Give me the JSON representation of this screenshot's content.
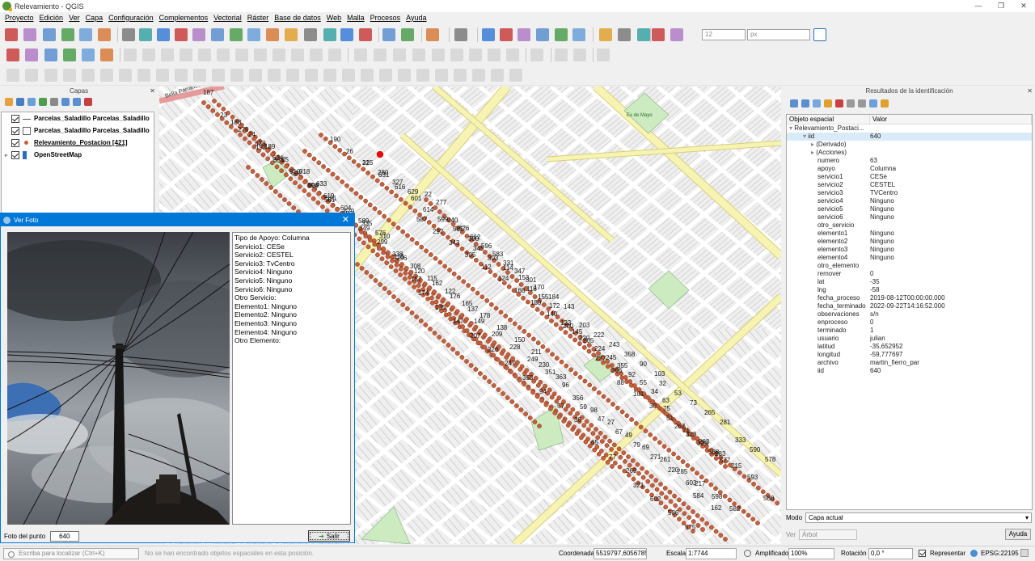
{
  "window": {
    "title": "Relevamiento - QGIS",
    "minimize": "—",
    "maximize": "❐",
    "close": "✕"
  },
  "menu": [
    "Proyecto",
    "Edición",
    "Ver",
    "Capa",
    "Configuración",
    "Complementos",
    "Vectorial",
    "Ráster",
    "Base de datos",
    "Web",
    "Malla",
    "Procesos",
    "Ayuda"
  ],
  "toolbar": {
    "scale_combo": "12",
    "unit_combo": "px"
  },
  "layers_panel": {
    "title": "Capas",
    "close": "✕",
    "layers": [
      {
        "name": "Parcelas_Saladillo Parcelas_Saladillo",
        "symbol": "line"
      },
      {
        "name": "Parcelas_Saladillo Parcelas_Saladillo",
        "symbol": "polygon"
      },
      {
        "name": "Relevamiento_Postacion [421]",
        "symbol": "point"
      },
      {
        "name": "OpenStreetMap",
        "symbol": "raster"
      }
    ]
  },
  "dialog": {
    "title": "Ver Foto",
    "close": "✕",
    "info": [
      "Tipo de Apoyo: Columna",
      "Servicio1: CESe",
      "Servicio2: CESTEL",
      "Servicio3: TvCentro",
      "Servicio4: Ninguno",
      "Servicio5: Ninguno",
      "Servicio6: Ninguno",
      "Otro Servicio:",
      "Elemento1: Ninguno",
      "Elemento2: Ninguno",
      "Elemento3: Ninguno",
      "Elemento4: Ninguno",
      "Otro Elemento:"
    ],
    "photo_label": "Foto del punto",
    "photo_value": "640",
    "exit_label": "Salir"
  },
  "map": {
    "street_label": "Bella Parranosa",
    "plaza_label": "Ex de Mayo",
    "point_labels": [
      {
        "t": "187"
      },
      {
        "t": "188"
      },
      {
        "t": "189"
      },
      {
        "t": "190"
      },
      {
        "t": "21"
      },
      {
        "t": "22"
      },
      {
        "t": "23"
      },
      {
        "t": "24"
      },
      {
        "t": "25"
      },
      {
        "t": "26"
      },
      {
        "t": "280"
      },
      {
        "t": "277"
      },
      {
        "t": "276"
      },
      {
        "t": "193"
      },
      {
        "t": "318"
      },
      {
        "t": "325"
      },
      {
        "t": "327"
      },
      {
        "t": "240"
      },
      {
        "t": "638"
      },
      {
        "t": "635"
      },
      {
        "t": "633"
      },
      {
        "t": "631"
      },
      {
        "t": "629"
      },
      {
        "t": "626"
      },
      {
        "t": "624"
      },
      {
        "t": "622"
      },
      {
        "t": "619"
      },
      {
        "t": "616"
      },
      {
        "t": "614"
      },
      {
        "t": "612"
      },
      {
        "t": "610"
      },
      {
        "t": "608"
      },
      {
        "t": "604"
      },
      {
        "t": "601"
      },
      {
        "t": "599"
      },
      {
        "t": "596"
      },
      {
        "t": "594"
      },
      {
        "t": "591"
      },
      {
        "t": "589"
      },
      {
        "t": "587"
      },
      {
        "t": "585"
      },
      {
        "t": "583"
      },
      {
        "t": "581"
      },
      {
        "t": "579"
      },
      {
        "t": "576"
      },
      {
        "t": "292"
      },
      {
        "t": "330"
      },
      {
        "t": "331"
      },
      {
        "t": "332"
      },
      {
        "t": "335"
      },
      {
        "t": "338"
      },
      {
        "t": "343"
      },
      {
        "t": "345"
      },
      {
        "t": "347"
      },
      {
        "t": "349"
      },
      {
        "t": "310"
      },
      {
        "t": "308"
      },
      {
        "t": "305"
      },
      {
        "t": "303"
      },
      {
        "t": "301"
      },
      {
        "t": "299"
      },
      {
        "t": "296"
      },
      {
        "t": "115"
      },
      {
        "t": "112"
      },
      {
        "t": "114"
      },
      {
        "t": "116"
      },
      {
        "t": "118"
      },
      {
        "t": "120"
      },
      {
        "t": "122"
      },
      {
        "t": "124"
      },
      {
        "t": "153"
      },
      {
        "t": "155"
      },
      {
        "t": "157"
      },
      {
        "t": "162"
      },
      {
        "t": "165"
      },
      {
        "t": "168"
      },
      {
        "t": "170"
      },
      {
        "t": "172"
      },
      {
        "t": "174"
      },
      {
        "t": "176"
      },
      {
        "t": "178"
      },
      {
        "t": "180"
      },
      {
        "t": "184"
      },
      {
        "t": "133"
      },
      {
        "t": "135"
      },
      {
        "t": "137"
      },
      {
        "t": "138"
      },
      {
        "t": "140"
      },
      {
        "t": "143"
      },
      {
        "t": "145"
      },
      {
        "t": "147"
      },
      {
        "t": "149"
      },
      {
        "t": "150"
      },
      {
        "t": "200"
      },
      {
        "t": "203"
      },
      {
        "t": "205"
      },
      {
        "t": "207"
      },
      {
        "t": "209"
      },
      {
        "t": "211"
      },
      {
        "t": "220"
      },
      {
        "t": "222"
      },
      {
        "t": "224"
      },
      {
        "t": "226"
      },
      {
        "t": "228"
      },
      {
        "t": "230"
      },
      {
        "t": "237"
      },
      {
        "t": "243"
      },
      {
        "t": "245"
      },
      {
        "t": "247"
      },
      {
        "t": "249"
      },
      {
        "t": "363"
      },
      {
        "t": "366"
      },
      {
        "t": "358"
      },
      {
        "t": "355"
      },
      {
        "t": "353"
      },
      {
        "t": "351"
      },
      {
        "t": "356"
      },
      {
        "t": "88"
      },
      {
        "t": "90"
      },
      {
        "t": "92"
      },
      {
        "t": "94"
      },
      {
        "t": "96"
      },
      {
        "t": "98"
      },
      {
        "t": "101"
      },
      {
        "t": "103"
      },
      {
        "t": "55"
      },
      {
        "t": "57"
      },
      {
        "t": "59"
      },
      {
        "t": "27"
      },
      {
        "t": "30"
      },
      {
        "t": "32"
      },
      {
        "t": "34"
      },
      {
        "t": "36"
      },
      {
        "t": "47"
      },
      {
        "t": "49"
      },
      {
        "t": "51"
      },
      {
        "t": "53"
      },
      {
        "t": "63"
      },
      {
        "t": "65"
      },
      {
        "t": "67"
      },
      {
        "t": "69"
      },
      {
        "t": "71"
      },
      {
        "t": "73"
      },
      {
        "t": "75"
      },
      {
        "t": "77"
      },
      {
        "t": "79"
      },
      {
        "t": "261"
      },
      {
        "t": "263"
      },
      {
        "t": "265"
      },
      {
        "t": "267"
      },
      {
        "t": "269"
      },
      {
        "t": "271"
      },
      {
        "t": "285"
      },
      {
        "t": "283"
      },
      {
        "t": "281"
      },
      {
        "t": "323"
      },
      {
        "t": "321"
      },
      {
        "t": "220"
      },
      {
        "t": "217"
      },
      {
        "t": "215"
      },
      {
        "t": "333"
      },
      {
        "t": "329"
      },
      {
        "t": "602"
      },
      {
        "t": "603"
      },
      {
        "t": "598"
      },
      {
        "t": "593"
      },
      {
        "t": "590"
      },
      {
        "t": "588"
      },
      {
        "t": "586"
      },
      {
        "t": "584"
      },
      {
        "t": "582"
      },
      {
        "t": "580"
      },
      {
        "t": "578"
      },
      {
        "t": "577"
      },
      {
        "t": "575"
      },
      {
        "t": "162"
      }
    ]
  },
  "identify_panel": {
    "title": "Resultados de la identificación",
    "close": "✕",
    "col_feature": "Objeto espacial",
    "col_value": "Valor",
    "layer_node": "Relevamiento_Postaci...",
    "rows": [
      {
        "k": "iid",
        "v": "640",
        "indent": 2,
        "exp": "▾"
      },
      {
        "k": "(Derivado)",
        "v": "",
        "indent": 3,
        "exp": "▸"
      },
      {
        "k": "(Acciones)",
        "v": "",
        "indent": 3,
        "exp": "▸"
      },
      {
        "k": "numero",
        "v": "63",
        "indent": 3
      },
      {
        "k": "apoyo",
        "v": "Columna",
        "indent": 3
      },
      {
        "k": "servicio1",
        "v": "CESe",
        "indent": 3
      },
      {
        "k": "servicio2",
        "v": "CESTEL",
        "indent": 3
      },
      {
        "k": "servicio3",
        "v": "TVCentro",
        "indent": 3
      },
      {
        "k": "servicio4",
        "v": "Ninguno",
        "indent": 3
      },
      {
        "k": "servicio5",
        "v": "Ninguno",
        "indent": 3
      },
      {
        "k": "servicio6",
        "v": "Ninguno",
        "indent": 3
      },
      {
        "k": "otro_servicio",
        "v": "",
        "indent": 3
      },
      {
        "k": "elemento1",
        "v": "Ninguno",
        "indent": 3
      },
      {
        "k": "elemento2",
        "v": "Ninguno",
        "indent": 3
      },
      {
        "k": "elemento3",
        "v": "Ninguno",
        "indent": 3
      },
      {
        "k": "elemento4",
        "v": "Ninguno",
        "indent": 3
      },
      {
        "k": "otro_elemento",
        "v": "",
        "indent": 3
      },
      {
        "k": "remover",
        "v": "0",
        "indent": 3
      },
      {
        "k": "lat",
        "v": "-35",
        "indent": 3
      },
      {
        "k": "lng",
        "v": "-58",
        "indent": 3
      },
      {
        "k": "fecha_proceso",
        "v": "2019-08-12T00:00:00.000",
        "indent": 3
      },
      {
        "k": "fecha_terminado",
        "v": "2022-09-22T14:16:52.000",
        "indent": 3
      },
      {
        "k": "observaciones",
        "v": "s/n",
        "indent": 3
      },
      {
        "k": "enproceso",
        "v": "0",
        "indent": 3
      },
      {
        "k": "terminado",
        "v": "1",
        "indent": 3
      },
      {
        "k": "usuario",
        "v": "julian",
        "indent": 3
      },
      {
        "k": "latitud",
        "v": "-35,652952",
        "indent": 3
      },
      {
        "k": "longitud",
        "v": "-59,777697",
        "indent": 3
      },
      {
        "k": "archivo",
        "v": "martin_fierro_par",
        "indent": 3
      },
      {
        "k": "iid",
        "v": "640",
        "indent": 3
      }
    ],
    "mode_label": "Modo",
    "mode_value": "Capa actual",
    "view_label": "Ver",
    "view_value": "Árbol",
    "help_label": "Ayuda"
  },
  "statusbar": {
    "locate_placeholder": "Escriba para localizar (Ctrl+K)",
    "message": "No se han encontrado objetos espaciales en esta posición.",
    "coord_label": "Coordenada",
    "coord_value": "5519797,6056785",
    "scale_label": "Escala",
    "scale_value": "1:7744",
    "magnifier_label": "Amplificador",
    "magnifier_value": "100%",
    "rotation_label": "Rotación",
    "rotation_value": "0,0 °",
    "render_label": "Representar",
    "crs": "EPSG:22195"
  },
  "colors": {
    "accent": "#0078d7",
    "point": "#c8603c",
    "selected_point": "#ff0000",
    "road": "#f7f4b3",
    "park": "#cdebc0"
  }
}
